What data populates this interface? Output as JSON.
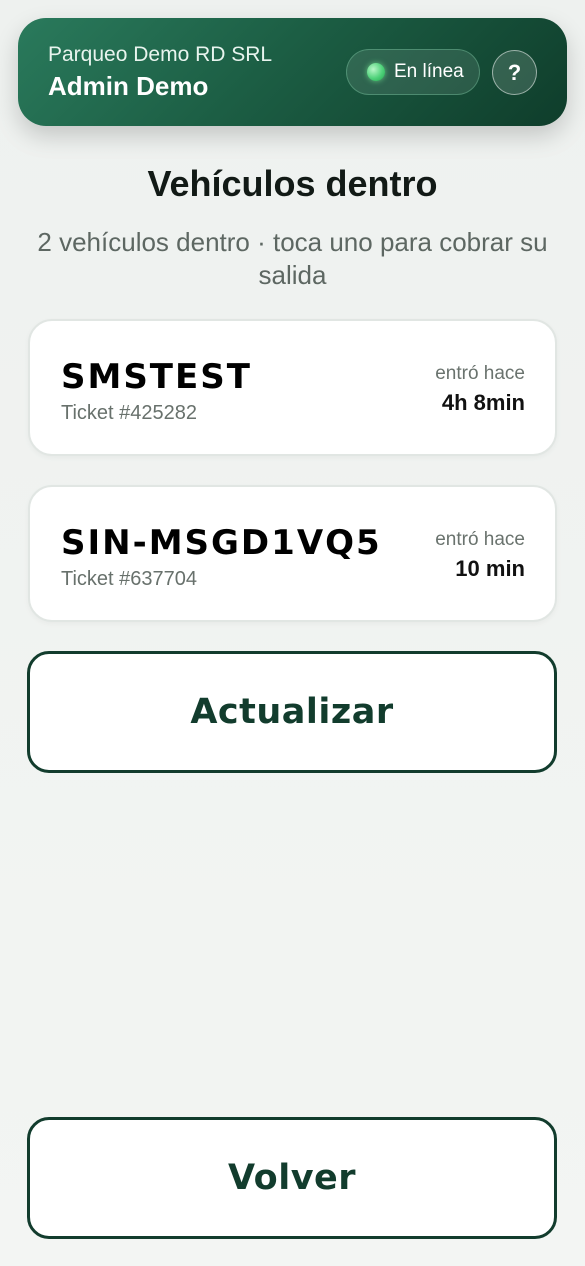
{
  "header": {
    "org_name": "Parqueo Demo RD SRL",
    "user_name": "Admin Demo",
    "status_label": "En línea",
    "help_label": "?",
    "colors": {
      "header_dark": "#0f3d2b",
      "header_light": "#2a7a5c",
      "online_dot": "#4fd27a"
    }
  },
  "page": {
    "title": "Vehículos dentro",
    "subtitle": "2 vehículos dentro · toca uno para cobrar su salida"
  },
  "vehicles": [
    {
      "plate": "SMSTEST",
      "ticket": "Ticket #425282",
      "entered_label": "entró hace",
      "entered_time": "4h 8min"
    },
    {
      "plate": "SIN-MSGD1VQ5",
      "ticket": "Ticket #637704",
      "entered_label": "entró hace",
      "entered_time": "10 min"
    }
  ],
  "actions": {
    "refresh_label": "Actualizar",
    "back_label": "Volver",
    "accent_color": "#123c2d"
  }
}
